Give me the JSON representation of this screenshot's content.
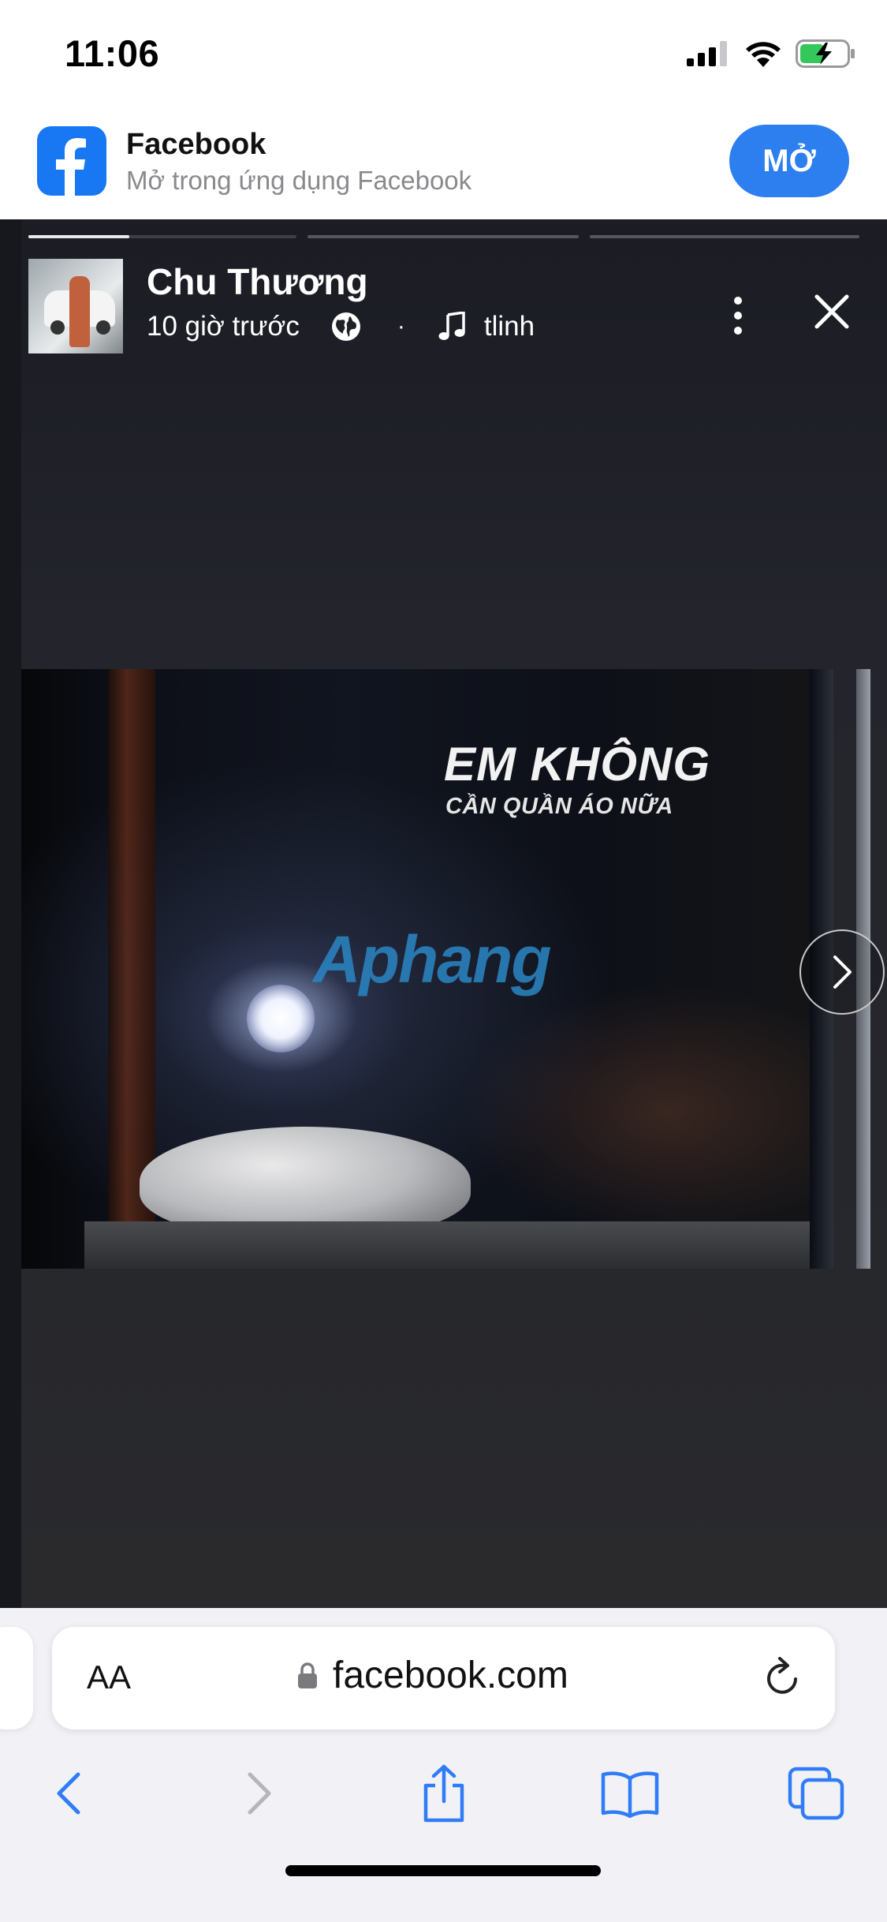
{
  "status_bar": {
    "time": "11:06",
    "icons": [
      "cellular-signal-icon",
      "wifi-icon",
      "battery-charging-icon"
    ]
  },
  "app_banner": {
    "app_name": "Facebook",
    "subtitle": "Mở trong ứng dụng Facebook",
    "open_button": "MỞ",
    "colors": {
      "brand": "#1877f2",
      "button": "#2d7ff0"
    }
  },
  "story": {
    "progress": {
      "segments": 4,
      "active_index": 0,
      "active_fill": 0.35
    },
    "author": "Chu Thương",
    "time_ago": "10 giờ trước",
    "separator": "·",
    "music": "tlinh",
    "icons": [
      "globe-icon",
      "music-note-icon",
      "more-icon",
      "close-icon",
      "chevron-right-icon"
    ],
    "video": {
      "title": "EM KHÔNG",
      "subtitle": "CẦN QUẦN ÁO NỮA",
      "watermark": "Aphang"
    }
  },
  "safari": {
    "text_size_button": "AA",
    "url": "facebook.com",
    "toolbar": [
      "back",
      "forward",
      "share",
      "bookmarks",
      "tabs"
    ]
  }
}
